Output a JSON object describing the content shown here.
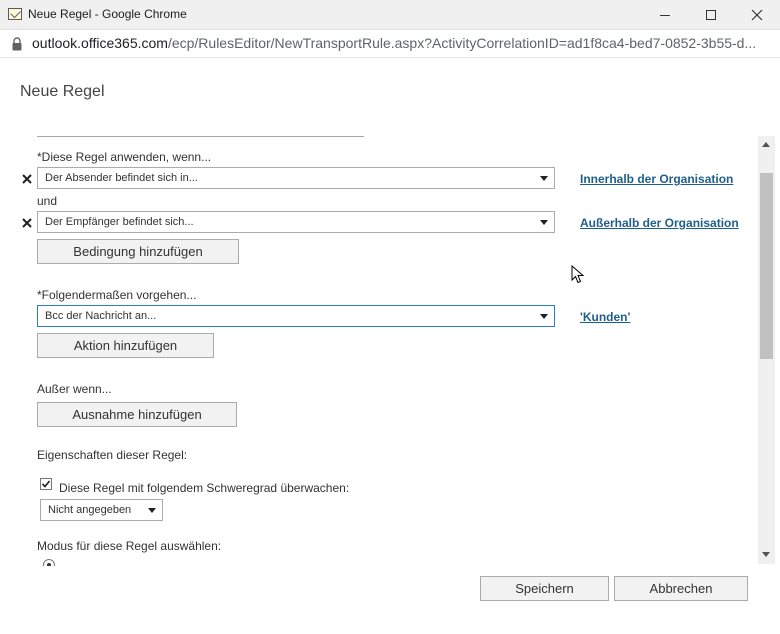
{
  "window": {
    "title": "Neue Regel - Google Chrome"
  },
  "address": {
    "host": "outlook.office365.com",
    "path": "/ecp/RulesEditor/NewTransportRule.aspx?ActivityCorrelationID=ad1f8ca4-bed7-0852-3b55-d..."
  },
  "dialog": {
    "title": "Neue Regel"
  },
  "conditions": {
    "label": "*Diese Regel anwenden, wenn...",
    "connector": "und",
    "rows": [
      {
        "value": "Der Absender befindet sich in...",
        "link": "Innerhalb der Organisation"
      },
      {
        "value": "Der Empfänger befindet sich...",
        "link": "Außerhalb der Organisation"
      }
    ],
    "add_button": "Bedingung hinzufügen"
  },
  "actions": {
    "label": "*Folgendermaßen vorgehen...",
    "value": "Bcc der Nachricht an...",
    "link": "'Kunden'",
    "add_button": "Aktion hinzufügen"
  },
  "exceptions": {
    "label": "Außer wenn...",
    "add_button": "Ausnahme hinzufügen"
  },
  "properties": {
    "label": "Eigenschaften dieser Regel:",
    "audit_checkbox_label": "Diese Regel mit folgendem Schweregrad überwachen:",
    "audit_checked": true,
    "severity_value": "Nicht angegeben",
    "mode_label": "Modus für diese Regel auswählen:"
  },
  "footer": {
    "save": "Speichern",
    "cancel": "Abbrechen"
  },
  "colors": {
    "link": "#1f5f8b",
    "focus_border": "#2f7bd2",
    "button_bg": "#f2f2f2",
    "scroll_thumb": "#c1c1c1"
  }
}
